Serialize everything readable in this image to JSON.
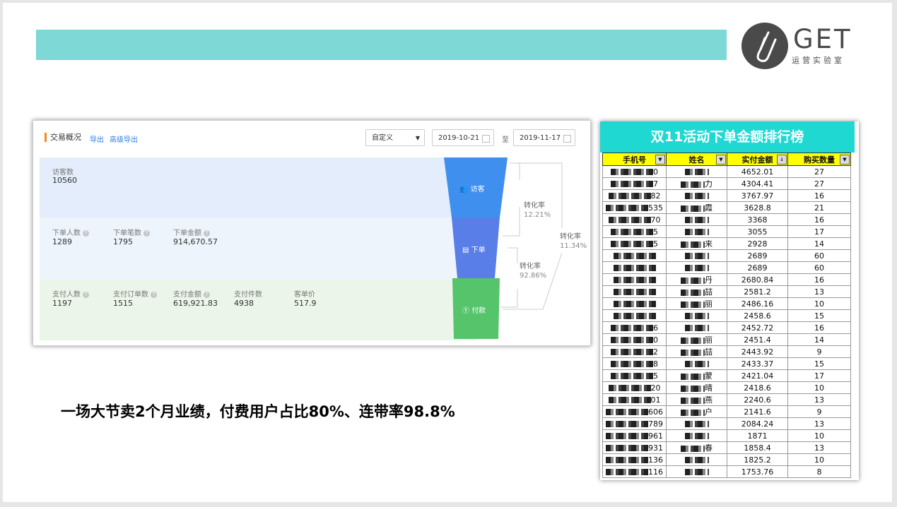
{
  "brand": {
    "name": "GET",
    "subtitle": "运营实验室"
  },
  "overview": {
    "title": "交易概况",
    "export_label": "导出",
    "advanced_export_label": "高级导出",
    "range_select": "自定义",
    "date_from": "2019-10-21",
    "date_sep": "至",
    "date_to": "2019-11-17",
    "visitors": {
      "label": "访客数",
      "value": "10560"
    },
    "order": [
      {
        "label": "下单人数",
        "value": "1289"
      },
      {
        "label": "下单笔数",
        "value": "1795"
      },
      {
        "label": "下单金额",
        "value": "914,670.57"
      }
    ],
    "pay": [
      {
        "label": "支付人数",
        "value": "1197"
      },
      {
        "label": "支付订单数",
        "value": "1515"
      },
      {
        "label": "支付金额",
        "value": "619,921.83"
      },
      {
        "label": "支付件数",
        "value": "4938"
      },
      {
        "label": "客单价",
        "value": "517.9"
      }
    ],
    "funnel": {
      "visit": "访客",
      "order": "下单",
      "pay": "付款",
      "colors": {
        "visit": "#3f8fef",
        "order": "#5a7ee8",
        "pay": "#55c46b"
      }
    },
    "conversions": [
      {
        "label": "转化率",
        "value": "12.21%"
      },
      {
        "label": "转化率",
        "value": "92.86%"
      },
      {
        "label": "转化率",
        "value": "11.34%"
      }
    ]
  },
  "ranking": {
    "title": "双11活动下单金额排行榜",
    "headers": [
      "手机号",
      "姓名",
      "实付金额",
      "购买数量"
    ],
    "rows": [
      {
        "phone_end": "0",
        "name_end": "",
        "amount": "4652.01",
        "qty": "27"
      },
      {
        "phone_end": "7",
        "name_end": "力",
        "amount": "4304.41",
        "qty": "27"
      },
      {
        "phone_end": "82",
        "name_end": "",
        "amount": "3767.97",
        "qty": "16"
      },
      {
        "phone_end": "535",
        "name_end": "霞",
        "amount": "3628.8",
        "qty": "21"
      },
      {
        "phone_end": "70",
        "name_end": "",
        "amount": "3368",
        "qty": "16"
      },
      {
        "phone_end": "5",
        "name_end": "",
        "amount": "3055",
        "qty": "17"
      },
      {
        "phone_end": "5",
        "name_end": "来",
        "amount": "2928",
        "qty": "14"
      },
      {
        "phone_end": "",
        "name_end": "",
        "amount": "2689",
        "qty": "60"
      },
      {
        "phone_end": "",
        "name_end": "",
        "amount": "2689",
        "qty": "60"
      },
      {
        "phone_end": "",
        "name_end": "丹",
        "amount": "2680.84",
        "qty": "16"
      },
      {
        "phone_end": "",
        "name_end": "喆",
        "amount": "2581.2",
        "qty": "13"
      },
      {
        "phone_end": "",
        "name_end": "丽",
        "amount": "2486.16",
        "qty": "10"
      },
      {
        "phone_end": "",
        "name_end": "",
        "amount": "2458.6",
        "qty": "15"
      },
      {
        "phone_end": "6",
        "name_end": "",
        "amount": "2452.72",
        "qty": "16"
      },
      {
        "phone_end": "0",
        "name_end": "丽",
        "amount": "2451.4",
        "qty": "14"
      },
      {
        "phone_end": "2",
        "name_end": "喆",
        "amount": "2443.92",
        "qty": "9"
      },
      {
        "phone_end": "8",
        "name_end": "",
        "amount": "2433.37",
        "qty": "15"
      },
      {
        "phone_end": "5",
        "name_end": "蒙",
        "amount": "2421.04",
        "qty": "17"
      },
      {
        "phone_end": "20",
        "name_end": "晴",
        "amount": "2418.6",
        "qty": "10"
      },
      {
        "phone_end": "01",
        "name_end": "燕",
        "amount": "2240.6",
        "qty": "13"
      },
      {
        "phone_end": "606",
        "name_end": "户",
        "amount": "2141.6",
        "qty": "9"
      },
      {
        "phone_end": "789",
        "name_end": "",
        "amount": "2084.24",
        "qty": "13"
      },
      {
        "phone_end": "961",
        "name_end": "",
        "amount": "1871",
        "qty": "10"
      },
      {
        "phone_end": "931",
        "name_end": "春",
        "amount": "1858.4",
        "qty": "13"
      },
      {
        "phone_end": "136",
        "name_end": "",
        "amount": "1825.2",
        "qty": "10"
      },
      {
        "phone_end": "116",
        "name_end": "",
        "amount": "1753.76",
        "qty": "8"
      }
    ]
  },
  "headline": "一场大节卖2个月业绩，付费用户占比80%、连带率98.8%"
}
